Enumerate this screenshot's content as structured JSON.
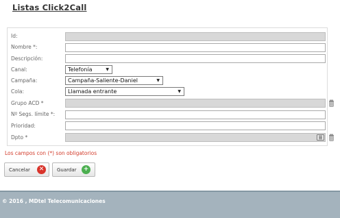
{
  "title": "Listas Click2Call",
  "fields": {
    "id": {
      "label": "Id:",
      "value": ""
    },
    "nombre": {
      "label": "Nombre *:",
      "value": ""
    },
    "descripcion": {
      "label": "Descripción:",
      "value": ""
    },
    "canal": {
      "label": "Canal:",
      "selected": "Telefonía"
    },
    "campana": {
      "label": "Campaña:",
      "selected": "Campaña-Saliente-Daniel"
    },
    "cola": {
      "label": "Cola:",
      "selected": "Llamada entrante"
    },
    "grupo_acd": {
      "label": "Grupo ACD *",
      "value": ""
    },
    "segs_limite": {
      "label": "Nº Segs. límite *:",
      "value": ""
    },
    "prioridad": {
      "label": "Prioridad:",
      "value": ""
    },
    "dpto": {
      "label": "Dpto *",
      "value": ""
    }
  },
  "required_note": "Los campos con (*) son obligatorios",
  "buttons": {
    "cancel": "Cancelar",
    "save": "Guardar"
  },
  "colors": {
    "error": "#d23b2a",
    "cancel_icon": "#d9342b",
    "save_icon": "#4caf50",
    "footer_bg": "#a4b3bd"
  },
  "footer": {
    "text": "© 2016 , MDtel Telecomunicaciones"
  }
}
